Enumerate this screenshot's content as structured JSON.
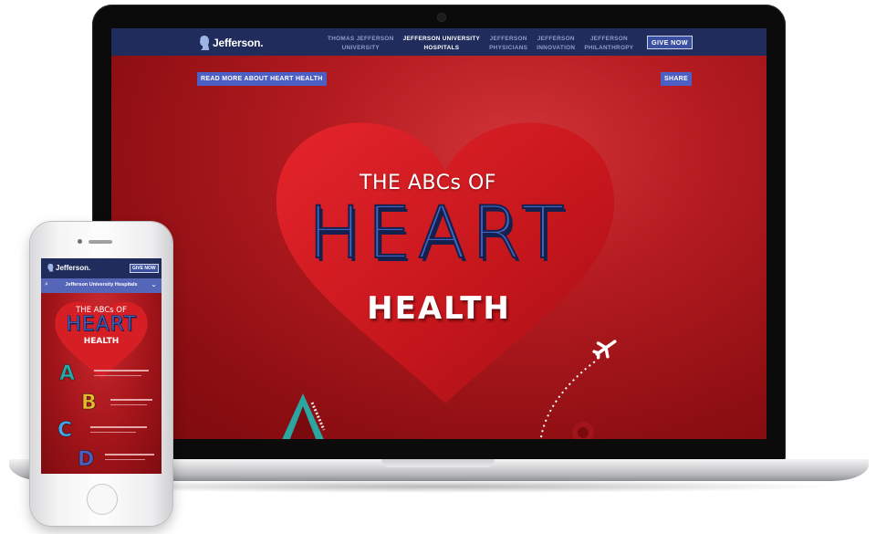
{
  "laptop": {
    "nav": {
      "logo_text": "Jefferson.",
      "items": [
        {
          "label": "THOMAS JEFFERSON\nUNIVERSITY",
          "active": false
        },
        {
          "label": "JEFFERSON UNIVERSITY\nHOSPITALS",
          "active": true
        },
        {
          "label": "JEFFERSON\nPHYSICIANS",
          "active": false
        },
        {
          "label": "JEFFERSON\nINNOVATION",
          "active": false
        },
        {
          "label": "JEFFERSON\nPHILANTHROPY",
          "active": false
        }
      ],
      "give_label": "GIVE NOW"
    },
    "read_more_label": "READ MORE ABOUT HEART HEALTH",
    "share_label": "SHARE",
    "headline": {
      "line1": "THE ABCs OF",
      "line2": "HEART",
      "line3": "HEALTH"
    },
    "colors": {
      "nav_bg": "#1f2c5c",
      "accent_button": "#4c5fc4",
      "hero_red": "#b31b20",
      "heart_red": "#cf1c22"
    }
  },
  "phone": {
    "logo_text": "Jefferson.",
    "give_label": "GIVE NOW",
    "menu_label": "Jefferson University Hospitals",
    "headline": {
      "line1": "THE ABCs OF",
      "line2": "HEART",
      "line3": "HEALTH"
    },
    "letters": [
      "A",
      "B",
      "C",
      "D"
    ]
  }
}
